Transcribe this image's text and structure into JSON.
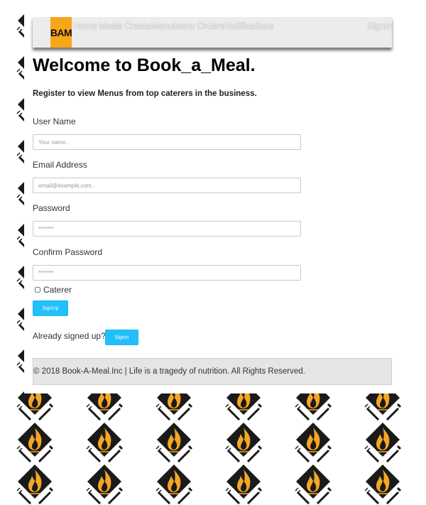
{
  "brand": "BAM",
  "nav": {
    "items": [
      {
        "label": "Home"
      },
      {
        "label": "Meals"
      },
      {
        "label": "CreateMenu"
      },
      {
        "label": "Menu"
      },
      {
        "label": "Orders"
      },
      {
        "label": "Notifications"
      }
    ],
    "signin_label": "SignIn"
  },
  "heading": "Welcome to Book_a_Meal.",
  "tagline": "Register to view Menus from top caterers in the business.",
  "form": {
    "username": {
      "label": "User Name",
      "placeholder": "Your name..",
      "value": ""
    },
    "email": {
      "label": "Email Address",
      "placeholder": "email@example.com..",
      "value": ""
    },
    "password": {
      "label": "Password",
      "placeholder": "*******",
      "value": ""
    },
    "confirm_password": {
      "label": "Confirm Password",
      "placeholder": "*******",
      "value": ""
    },
    "caterer_label": "Caterer",
    "caterer_checked": false,
    "signup_label": "SignUp"
  },
  "already_text": "Already signed up?",
  "signin_button_label": "SignIn",
  "footer": "© 2018 Book-A-Meal.Inc | Life is a tragedy of nutrition. All Rights Reserved.",
  "colors": {
    "brand_bg": "#f7a51a",
    "button_bg": "#21c0fb",
    "navbar_bg": "#ececec",
    "footer_bg": "#e5e5e5",
    "pattern_dark": "#1a1a1a",
    "pattern_flame": "#f5a623"
  },
  "icons": {
    "background_tile": "flame-fork-knife-icon"
  }
}
